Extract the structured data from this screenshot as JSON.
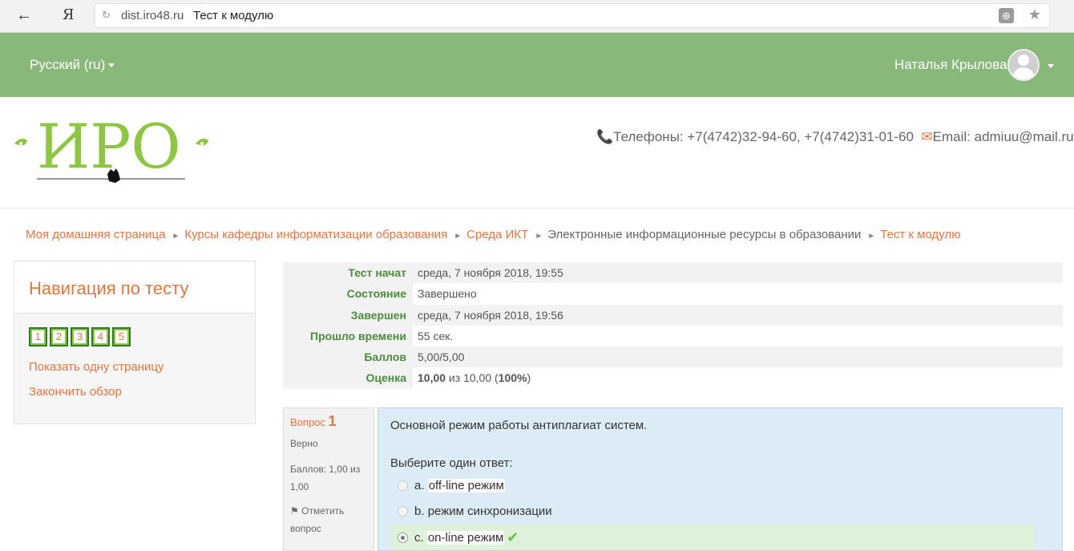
{
  "browser": {
    "back_icon": "←",
    "ya_label": "Я",
    "reload_icon": "↻",
    "domain": "dist.iro48.ru",
    "tab_title": "Тест к модулю",
    "globe_icon": "⊕",
    "star_icon": "★"
  },
  "topbar": {
    "language": "Русский (ru)",
    "user_name": "Наталья Крылова"
  },
  "header": {
    "logo_text": "ИРО",
    "phone_icon": "📞",
    "phones": "Телефоны: +7(4742)32-94-60, +7(4742)31-01-60",
    "email_icon": "✉",
    "email": "Email: admiuu@mail.ru"
  },
  "breadcrumb": {
    "items": [
      "Моя домашняя страница",
      "Курсы кафедры информатизации образования",
      "Среда ИКТ",
      "Электронные информационные ресурсы в образовании",
      "Тест к модулю"
    ],
    "separator": "►"
  },
  "nav": {
    "title": "Навигация по тесту",
    "questions": [
      "1",
      "2",
      "3",
      "4",
      "5"
    ],
    "show_one_page": "Показать одну страницу",
    "finish_review": "Закончить обзор"
  },
  "summary": {
    "rows": [
      {
        "label": "Тест начат",
        "value": "среда, 7 ноября 2018, 19:55"
      },
      {
        "label": "Состояние",
        "value": "Завершено"
      },
      {
        "label": "Завершен",
        "value": "среда, 7 ноября 2018, 19:56"
      },
      {
        "label": "Прошло времени",
        "value": "55 сек."
      },
      {
        "label": "Баллов",
        "value": "5,00/5,00"
      }
    ],
    "grade_label": "Оценка",
    "grade_value": "10,00",
    "grade_mid": " из 10,00 (",
    "grade_percent": "100%",
    "grade_end": ")"
  },
  "question": {
    "label": "Вопрос",
    "number": "1",
    "state": "Верно",
    "grade_line1": "Баллов: 1,00 из",
    "grade_line2": "1,00",
    "flag_icon": "⚑",
    "flag_line1": "Отметить",
    "flag_line2": "вопрос",
    "text": "Основной режим работы антиплагиат систем.",
    "prompt": "Выберите один ответ:",
    "answers": [
      {
        "letter": "a.",
        "text": "off-line режим",
        "selected": false
      },
      {
        "letter": "b.",
        "text": "режим синхронизации",
        "selected": false
      },
      {
        "letter": "c.",
        "text": "on-line режим",
        "selected": true,
        "correct": true
      }
    ],
    "tick_icon": "✔"
  }
}
